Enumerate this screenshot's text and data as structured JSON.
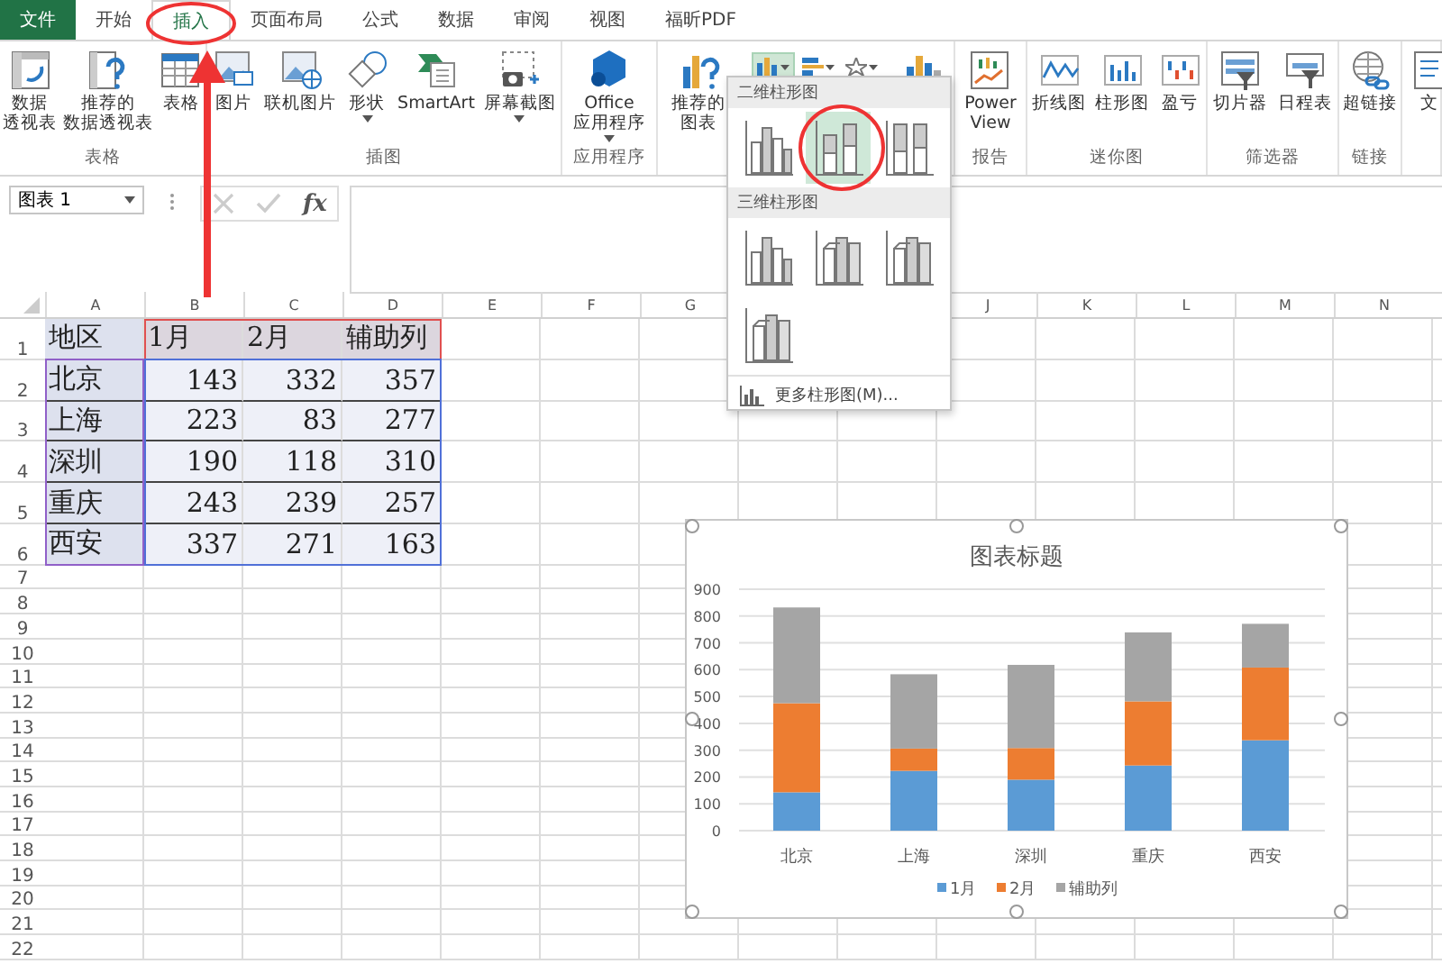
{
  "ribbon_tabs": [
    {
      "label": "文件",
      "kind": "file",
      "selected": false
    },
    {
      "label": "开始",
      "selected": false
    },
    {
      "label": "插入",
      "selected": true
    },
    {
      "label": "页面布局",
      "selected": false
    },
    {
      "label": "公式",
      "selected": false
    },
    {
      "label": "数据",
      "selected": false
    },
    {
      "label": "审阅",
      "selected": false
    },
    {
      "label": "视图",
      "selected": false
    },
    {
      "label": "福昕PDF",
      "selected": false
    }
  ],
  "ribbon_groups": [
    {
      "label": "表格",
      "commands": [
        {
          "lines": [
            "数据",
            "透视表"
          ]
        },
        {
          "lines": [
            "推荐的",
            "数据透视表"
          ]
        },
        {
          "label": "表格"
        }
      ]
    },
    {
      "label": "插图",
      "commands": [
        {
          "label": "图片"
        },
        {
          "label": "联机图片"
        },
        {
          "label": "形状",
          "has_menu": true
        },
        {
          "label": "SmartArt"
        },
        {
          "label": "屏幕截图",
          "has_menu": true
        }
      ]
    },
    {
      "label": "应用程序",
      "commands": [
        {
          "label": "Office\n应用程序",
          "has_menu": true
        }
      ]
    },
    {
      "kind": "charts",
      "commands": [
        {
          "lines": [
            "推荐的",
            "图表"
          ]
        }
      ],
      "chart_type_buttons": [
        {
          "expanded": true
        },
        {
          "expanded": false
        },
        {
          "expanded": false
        }
      ]
    },
    {
      "label": "报告",
      "commands": [
        {
          "label": "Power\nView"
        }
      ]
    },
    {
      "label": "迷你图",
      "commands": [
        {
          "label": "折线图"
        },
        {
          "label": "柱形图"
        },
        {
          "label": "盈亏"
        }
      ]
    },
    {
      "label": "筛选器",
      "commands": [
        {
          "label": "切片器"
        },
        {
          "label": "日程表"
        }
      ]
    },
    {
      "label": "链接",
      "commands": [
        {
          "label": "超链接"
        }
      ]
    },
    {
      "commands": [
        {
          "label": "文"
        }
      ]
    }
  ],
  "formula_bar": {
    "name_box": "图表 1",
    "function_label": "fx"
  },
  "sheet": {
    "columns": [
      {
        "label": "A"
      },
      {
        "label": "B"
      },
      {
        "label": "C"
      },
      {
        "label": "D"
      },
      {
        "label": "E"
      },
      {
        "label": "F"
      },
      {
        "label": "G"
      },
      {},
      {},
      {
        "label": "J"
      },
      {
        "label": "K"
      },
      {
        "label": "L"
      },
      {
        "label": "M"
      },
      {
        "label": "N"
      }
    ],
    "rows": [
      {
        "number": "1",
        "cells": [
          "地区",
          "1月",
          "2月",
          "辅助列"
        ]
      },
      {
        "number": "2",
        "cells": [
          "北京",
          "143",
          "332",
          "357"
        ]
      },
      {
        "number": "3",
        "cells": [
          "上海",
          "223",
          "83",
          "277"
        ]
      },
      {
        "number": "4",
        "cells": [
          "深圳",
          "190",
          "118",
          "310"
        ]
      },
      {
        "number": "5",
        "cells": [
          "重庆",
          "243",
          "239",
          "257"
        ]
      },
      {
        "number": "6",
        "cells": [
          "西安",
          "337",
          "271",
          "163"
        ]
      },
      {
        "number": "7"
      },
      {
        "number": "8"
      },
      {
        "number": "9"
      },
      {
        "number": "10"
      },
      {
        "number": "11"
      },
      {
        "number": "12"
      },
      {
        "number": "13"
      },
      {
        "number": "14"
      },
      {
        "number": "15"
      },
      {
        "number": "16"
      },
      {
        "number": "17"
      },
      {
        "number": "18"
      },
      {
        "number": "19"
      },
      {
        "number": "20"
      },
      {
        "number": "21"
      },
      {
        "number": "22"
      }
    ]
  },
  "chart": {
    "chart_data": {
      "type": "bar",
      "title": "图表标题",
      "categories": [
        "北京",
        "上海",
        "深圳",
        "重庆",
        "西安"
      ],
      "series": [
        {
          "name": "1月",
          "color": "#5b9bd5",
          "values": [
            143,
            223,
            190,
            243,
            337
          ]
        },
        {
          "name": "2月",
          "color": "#ed7d31",
          "values": [
            332,
            83,
            118,
            239,
            271
          ]
        },
        {
          "name": "辅助列",
          "color": "#a5a5a5",
          "values": [
            357,
            277,
            310,
            257,
            163
          ]
        }
      ],
      "ylim": [
        0,
        900
      ],
      "yticks": [
        0,
        100,
        200,
        300,
        400,
        500,
        600,
        700,
        800,
        900
      ],
      "stacked": true,
      "orientation": "vertical",
      "grid": true,
      "legend": "bottom"
    }
  },
  "chart_dropdown": {
    "sections": [
      {
        "title": "二维柱形图",
        "items": [
          {
            "selected": false
          },
          {
            "selected": true
          },
          {
            "selected": false
          }
        ]
      },
      {
        "title": "三维柱形图",
        "items": [
          {
            "selected": false
          },
          {
            "selected": false
          },
          {
            "selected": false
          },
          {
            "selected": false
          }
        ]
      }
    ],
    "more_label": "更多柱形图(M)..."
  }
}
